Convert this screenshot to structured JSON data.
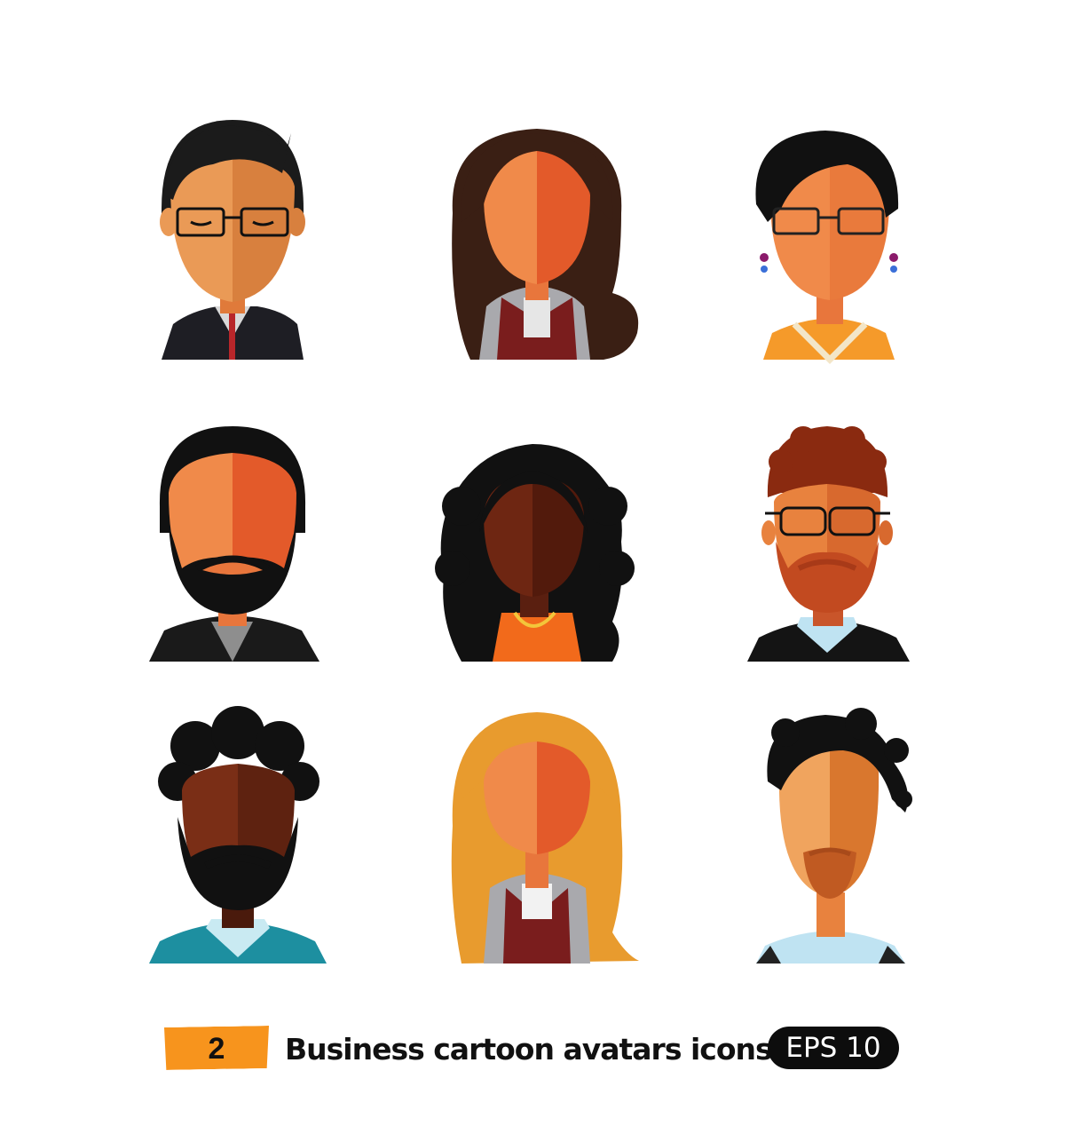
{
  "caption": {
    "number": "2",
    "title": "Business cartoon avatars icons",
    "format_badge": "EPS 10"
  },
  "colors": {
    "badge_orange": "#f7941d",
    "skin_light": "#f0894a",
    "skin_shadow": "#e35a2a",
    "dark_hair": "#1b1b1b",
    "background": "#ffffff"
  },
  "avatars": [
    {
      "kind": "man-glasses-suit"
    },
    {
      "kind": "woman-long-brown-hair"
    },
    {
      "kind": "woman-short-hair-glasses"
    },
    {
      "kind": "man-beard-suit"
    },
    {
      "kind": "woman-curly-afro"
    },
    {
      "kind": "man-red-curly-glasses"
    },
    {
      "kind": "man-dark-beard-teal"
    },
    {
      "kind": "woman-blonde-long"
    },
    {
      "kind": "man-curly-goatee"
    }
  ]
}
